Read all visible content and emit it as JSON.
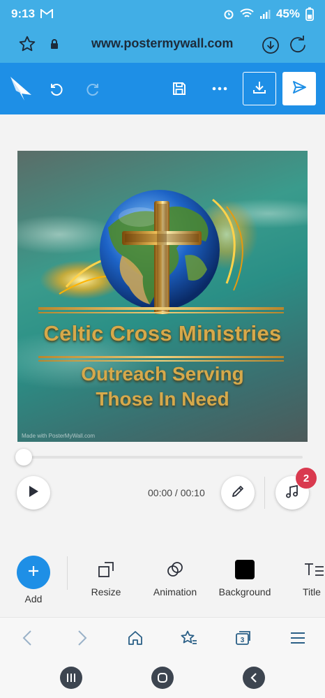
{
  "status_bar": {
    "time": "9:13",
    "battery": "45%"
  },
  "browser": {
    "url": "www.postermywall.com"
  },
  "poster": {
    "title": "Celtic Cross Ministries",
    "subtitle_line1": "Outreach Serving",
    "subtitle_line2": "Those In Need",
    "watermark": "Made with PosterMyWall.com"
  },
  "player": {
    "time": "00:00 / 00:10",
    "audio_badge": "2",
    "progress": 0
  },
  "tools": {
    "add": "Add",
    "resize": "Resize",
    "animation": "Animation",
    "background": "Background",
    "title": "Title"
  },
  "colors": {
    "toolbar": "#1e8fe6",
    "browser": "#41aee6",
    "badge": "#d93a4f",
    "text_gold": "#d6a94b"
  }
}
